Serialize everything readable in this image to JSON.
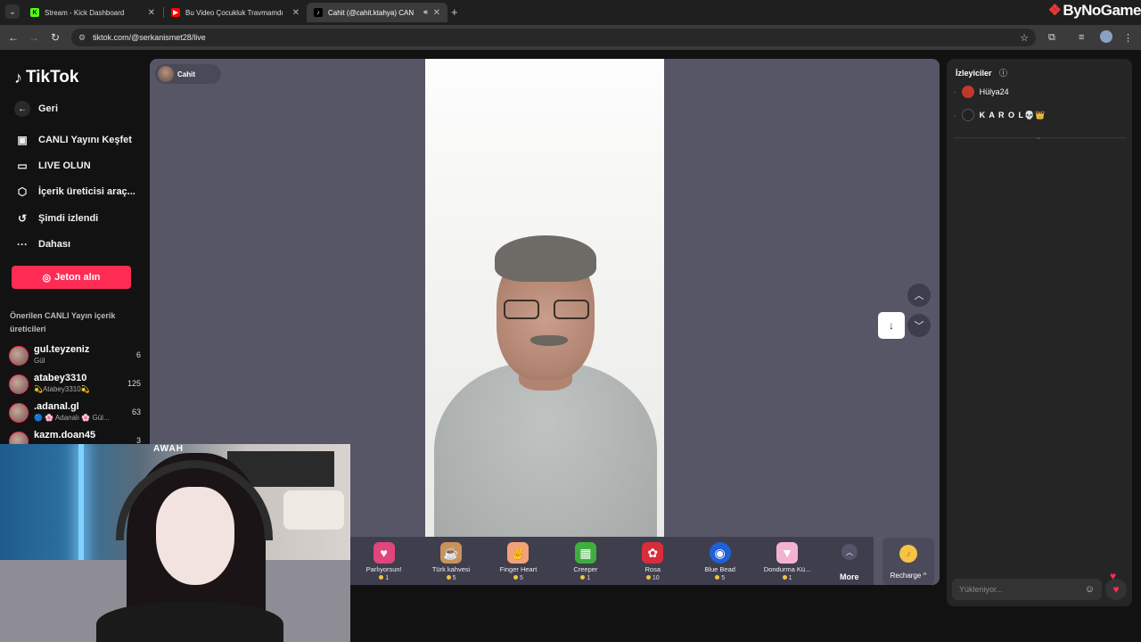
{
  "browser": {
    "tabs": [
      {
        "title": "Stream - Kick Dashboard",
        "favicon_color": "#53fc18",
        "favicon_letter": "K"
      },
      {
        "title": "Bu Video Çocukluk Travmamdı",
        "favicon_color": "#ff0000",
        "favicon_letter": "▶"
      },
      {
        "title": "Cahit (@cahit.ktahya) CAN",
        "favicon_color": "#000000",
        "favicon_letter": "♪"
      }
    ],
    "url": "tiktok.com/@serkanismet28/live",
    "overlay_brand": "ByNoGame"
  },
  "sidebar": {
    "logo": "TikTok",
    "back": "Geri",
    "nav": [
      {
        "label": "CANLI Yayını Keşfet",
        "icon": "live-tv-icon"
      },
      {
        "label": "LIVE OLUN",
        "icon": "camera-icon"
      },
      {
        "label": "İçerik üreticisi araç...",
        "icon": "creator-tools-icon"
      },
      {
        "label": "Şimdi izlendi",
        "icon": "history-icon"
      },
      {
        "label": "Dahası",
        "icon": "more-dots-icon"
      }
    ],
    "coins_button": "Jeton alın",
    "suggested_title": "Önerilen CANLI Yayın içerik üreticileri",
    "creators": [
      {
        "name": "gul.teyzeniz",
        "sub": "Gül",
        "count": "6"
      },
      {
        "name": "atabey3310",
        "sub": "💫Atabey3310💫",
        "count": "125"
      },
      {
        "name": ".adanal.gl",
        "sub": "🔵 🌸 Adanalı 🌸 Gül...",
        "count": "63"
      },
      {
        "name": "kazm.doan45",
        "sub": "",
        "count": "3"
      }
    ]
  },
  "stream": {
    "host_name": "Cahit",
    "gifts": [
      {
        "name": "Parlıyorsun!",
        "price": "1",
        "icon": "gift-heart-icon",
        "color": "#e0457b"
      },
      {
        "name": "Türk kahvesi",
        "price": "5",
        "icon": "coffee-icon",
        "color": "#c9925c"
      },
      {
        "name": "Finger Heart",
        "price": "5",
        "icon": "finger-heart-icon",
        "color": "#f2a27a"
      },
      {
        "name": "Creeper",
        "price": "1",
        "icon": "creeper-icon",
        "color": "#3fae3f"
      },
      {
        "name": "Rosa",
        "price": "10",
        "icon": "rose-icon",
        "color": "#d92d3a"
      },
      {
        "name": "Blue Bead",
        "price": "5",
        "icon": "evil-eye-icon",
        "color": "#2160d6"
      },
      {
        "name": "Dondurma Kü...",
        "price": "1",
        "icon": "ice-cream-icon",
        "color": "#f3b3d0"
      }
    ],
    "more_label": "More",
    "recharge_label": "Recharge ^"
  },
  "viewers": {
    "title": "İzleyiciler",
    "list": [
      {
        "name": "Hülya24",
        "color": "#c0392b"
      },
      {
        "name": "K A R O L💀👑",
        "color": "#222222"
      }
    ]
  },
  "chat": {
    "placeholder": "Yükleniyor..."
  },
  "webcam": {
    "wall_text": "AWAH"
  }
}
